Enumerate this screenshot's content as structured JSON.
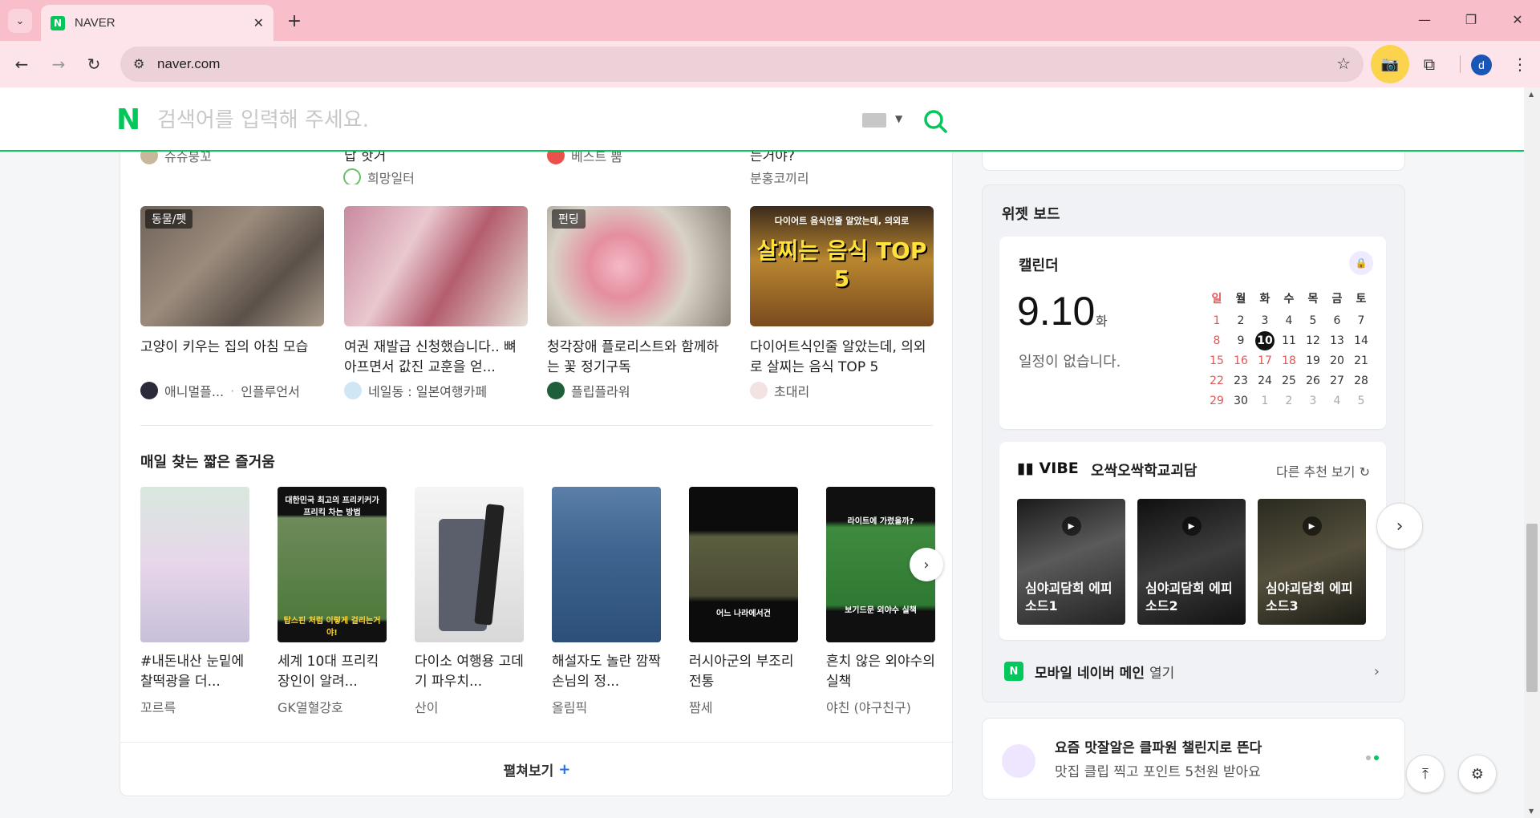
{
  "browser": {
    "tab_title": "NAVER",
    "url": "naver.com",
    "profile_initial": "d"
  },
  "search": {
    "placeholder": "검색어를 입력해 주세요."
  },
  "feed": {
    "cut_row": [
      {
        "author": "슈슈붕꼬"
      },
      {
        "title_fragment": "답 핫거",
        "author": "희망일터"
      },
      {
        "author": "베스트 뿜"
      },
      {
        "title_fragment": "는거야?",
        "author": "분홍코끼리"
      }
    ],
    "cards": [
      {
        "badge": "동물/펫",
        "title": "고양이 키우는 집의 아침 모습",
        "author": "애니멀플...",
        "tag": "인플루언서"
      },
      {
        "badge": "",
        "title": "여권 재발급 신청했습니다.. 뼈아프면서 값진 교훈을 얻...",
        "author": "네일동 : 일본여행카페",
        "tag": ""
      },
      {
        "badge": "펀딩",
        "title": "청각장애 플로리스트와 함께하는 꽃 정기구독",
        "author": "플립플라워",
        "tag": ""
      },
      {
        "badge": "",
        "title": "다이어트식인줄 알았는데, 의외로 살찌는 음식 TOP 5",
        "author": "초대리",
        "tag": ""
      }
    ],
    "card4_overlay": {
      "line1": "다이어트 음식인줄 알았는데, 의외로",
      "line2": "살찌는 음식 TOP 5"
    },
    "section_title": "매일 찾는 짧은 즐거움",
    "shorts": [
      {
        "title": "#내돈내산 눈밑에 찰떡광을 더...",
        "author": "꼬르륵"
      },
      {
        "title": "세계 10대 프리킥 장인이 알려...",
        "author": "GK열혈강호"
      },
      {
        "title": "다이소 여행용 고데기 파우치...",
        "author": "산이"
      },
      {
        "title": "해설자도 놀란 깜짝 손님의 정...",
        "author": "올림픽"
      },
      {
        "title": "러시아군의 부조리 전통",
        "author": "짬세"
      },
      {
        "title": "흔치 않은 외야수의 실책",
        "author": "야친 (야구친구)"
      }
    ],
    "short2_overlay": {
      "top": "대한민국 최고의 프리키커가 프리킥 차는 방법",
      "bottom": "탑스핀 처럼 이렇게 걸리는거야!"
    },
    "short5_overlay": "어느 나라에서건",
    "short6_overlay": {
      "top": "라이트에 가렸을까?",
      "bottom": "보기드문 외야수 실책"
    },
    "expand_label": "펼쳐보기"
  },
  "widget_board": {
    "title": "위젯 보드",
    "calendar": {
      "title": "캘린더",
      "date": "9.10",
      "day_of_week": "화",
      "empty_text": "일정이 없습니다.",
      "weekdays": [
        "일",
        "월",
        "화",
        "수",
        "목",
        "금",
        "토"
      ],
      "weeks": [
        [
          "1",
          "2",
          "3",
          "4",
          "5",
          "6",
          "7"
        ],
        [
          "8",
          "9",
          "10",
          "11",
          "12",
          "13",
          "14"
        ],
        [
          "15",
          "16",
          "17",
          "18",
          "19",
          "20",
          "21"
        ],
        [
          "22",
          "23",
          "24",
          "25",
          "26",
          "27",
          "28"
        ],
        [
          "29",
          "30",
          "1",
          "2",
          "3",
          "4",
          "5"
        ]
      ],
      "today": "10"
    },
    "vibe": {
      "logo": "VIBE",
      "playlist": "오싹오싹학교괴담",
      "more": "다른 추천 보기",
      "items": [
        {
          "label": "심야괴담회 에피소드1"
        },
        {
          "label": "심야괴담회 에피소드2"
        },
        {
          "label": "심야괴담회 에피소드3"
        }
      ]
    },
    "mobile_link": {
      "bold": "모바일 네이버 메인",
      "rest": "열기"
    }
  },
  "promo": {
    "title": "요즘 맛잘알은 클파원 챌린지로 뜬다",
    "subtitle": "맛집 클립 찍고 포인트 5천원 받아요"
  }
}
